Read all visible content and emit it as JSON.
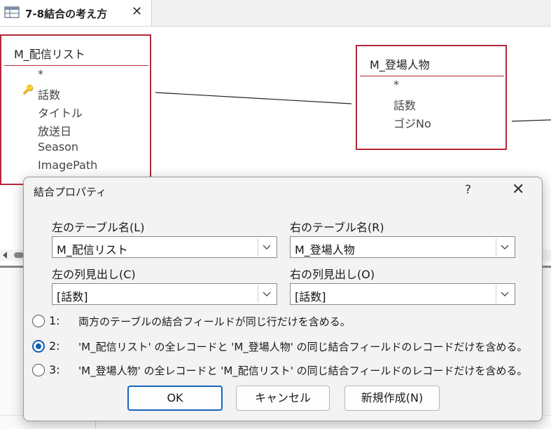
{
  "tab": {
    "title": "7-8結合の考え方",
    "icon": "query-design-icon",
    "close": "✕"
  },
  "tables": {
    "left": {
      "name": "M_配信リスト",
      "fields": [
        "*",
        "話数",
        "タイトル",
        "放送日",
        "Season",
        "ImagePath"
      ],
      "key_field": "話数"
    },
    "right": {
      "name": "M_登場人物",
      "fields": [
        "*",
        "話数",
        "ゴジNo"
      ]
    }
  },
  "dialog": {
    "title": "結合プロパティ",
    "help": "?",
    "close": "✕",
    "left_table_label": "左のテーブル名(L)",
    "left_table_value": "M_配信リスト",
    "right_table_label": "右のテーブル名(R)",
    "right_table_value": "M_登場人物",
    "left_column_label": "左の列見出し(C)",
    "left_column_value": "[話数]",
    "right_column_label": "右の列見出し(O)",
    "right_column_value": "[話数]",
    "options": [
      {
        "num": "1:",
        "text": "両方のテーブルの結合フィールドが同じ行だけを含める。",
        "checked": false
      },
      {
        "num": "2:",
        "text": "'M_配信リスト' の全レコードと 'M_登場人物' の同じ結合フィールドのレコードだけを含める。",
        "checked": true
      },
      {
        "num": "3:",
        "text": "'M_登場人物' の全レコードと 'M_配信リスト' の同じ結合フィールドのレコードだけを含める。",
        "checked": false
      }
    ],
    "buttons": {
      "ok": "OK",
      "cancel": "キャンセル",
      "new": "新規作成(N)"
    }
  },
  "colors": {
    "table_border": "#b32a3a",
    "accent": "#1565c0",
    "dialog_bg": "#f3f3f3"
  }
}
